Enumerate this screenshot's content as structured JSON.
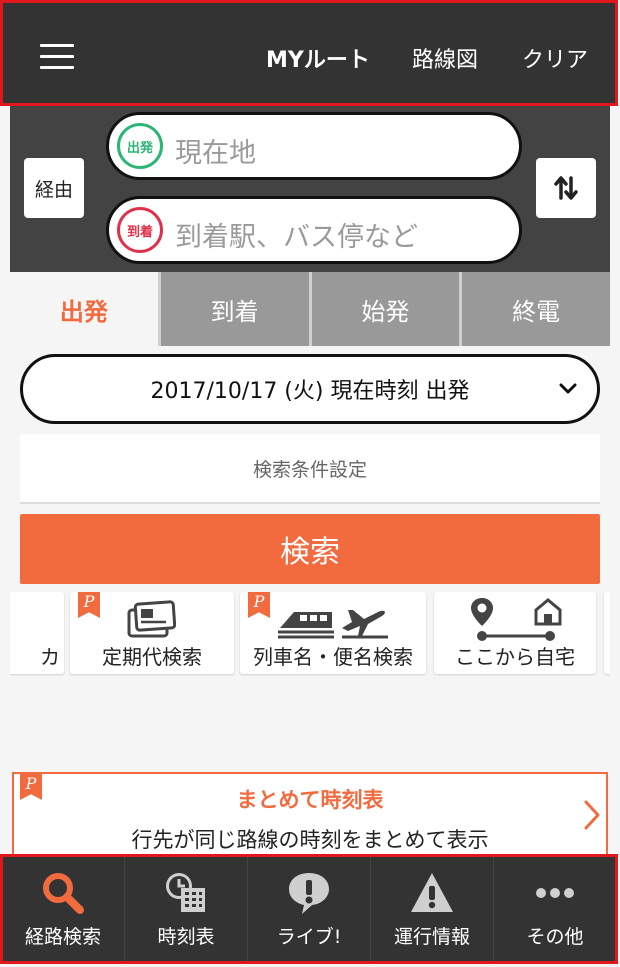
{
  "header": {
    "menu_icon": "hamburger-menu-icon",
    "my_route": "MYルート",
    "route_map": "路線図",
    "clear": "クリア"
  },
  "search": {
    "via_label": "経由",
    "from_badge": "出発",
    "from_placeholder": "現在地",
    "to_badge": "到着",
    "to_placeholder": "到着駅、バス停など",
    "swap_icon": "swap-arrows-icon"
  },
  "tabs": [
    {
      "label": "出発",
      "active": true
    },
    {
      "label": "到着",
      "active": false
    },
    {
      "label": "始発",
      "active": false
    },
    {
      "label": "終電",
      "active": false
    }
  ],
  "datetime": {
    "value": "2017/10/17 (火) 現在時刻 出発",
    "chevron": "⌄"
  },
  "conditions_label": "検索条件設定",
  "search_button": "検索",
  "shortcuts": [
    {
      "label": "カ",
      "icon": "partial-icon"
    },
    {
      "label": "定期代検索",
      "icon": "commuter-pass-icon",
      "point": "P"
    },
    {
      "label": "列車名・便名検索",
      "icon": "train-plane-icon",
      "point": "P"
    },
    {
      "label": "ここから自宅",
      "icon": "home-route-icon"
    }
  ],
  "banner": {
    "point": "P",
    "title": "まとめて時刻表",
    "description": "行先が同じ路線の時刻をまとめて表示",
    "arrow": "›"
  },
  "bottom_nav": [
    {
      "label": "経路検索",
      "icon": "search-icon",
      "active": true
    },
    {
      "label": "時刻表",
      "icon": "timetable-icon",
      "active": false
    },
    {
      "label": "ライブ!",
      "icon": "live-alert-icon",
      "active": false
    },
    {
      "label": "運行情報",
      "icon": "warning-icon",
      "active": false
    },
    {
      "label": "その他",
      "icon": "more-icon",
      "active": false
    }
  ],
  "colors": {
    "accent": "#f26b3f",
    "dark": "#333333",
    "from_green": "#2bb673",
    "to_red": "#e0314b",
    "annotation_red": "#e0171c"
  }
}
